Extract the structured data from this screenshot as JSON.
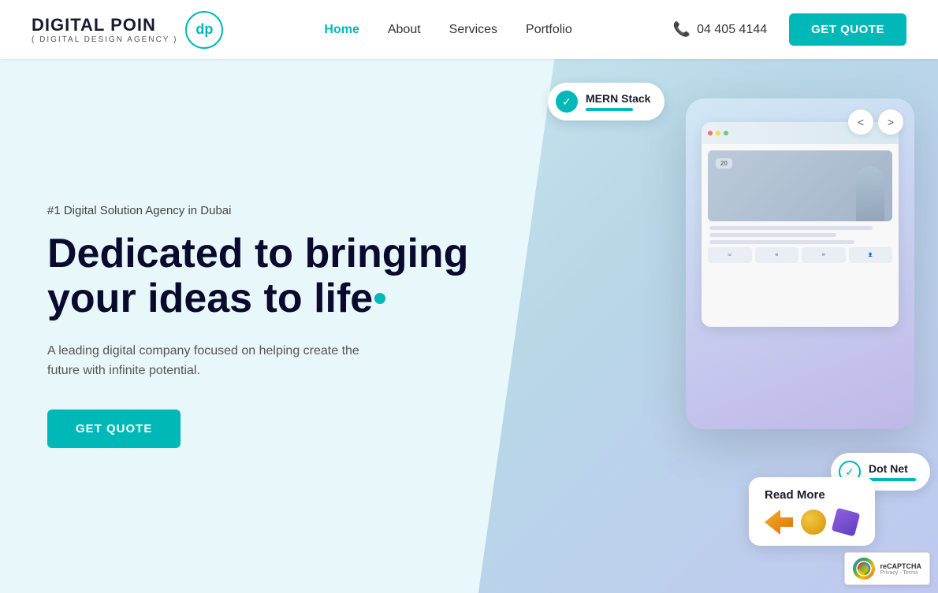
{
  "logo": {
    "title": "DIGITAL POIN",
    "subtitle": "( DIGITAL DESIGN AGENCY )",
    "icon_text": "dp"
  },
  "nav": {
    "home": "Home",
    "about": "About",
    "services": "Services",
    "portfolio": "Portfolio"
  },
  "header": {
    "phone": "04 405 4144",
    "cta": "GET QUOTE"
  },
  "hero": {
    "subtitle": "#1 Digital Solution Agency in Dubai",
    "title_line1": "Dedicated to bringing",
    "title_line2": "your ideas to life",
    "desc": "A leading digital company focused on helping create the future with infinite potential.",
    "cta": "GET QUOTE"
  },
  "badges": {
    "mern": {
      "label": "MERN Stack"
    },
    "dotnet": {
      "label": "Dot Net"
    },
    "read_more": {
      "label": "Read More"
    }
  },
  "mockup": {
    "nav_prev": "<",
    "nav_next": ">"
  },
  "recaptcha": {
    "icon": "rC",
    "brand": "reCAPTCHA",
    "terms": "Privacy - Terms"
  },
  "colors": {
    "teal": "#00b8b8",
    "dark": "#0a0a2e",
    "light_bg": "#e8f7f9"
  }
}
